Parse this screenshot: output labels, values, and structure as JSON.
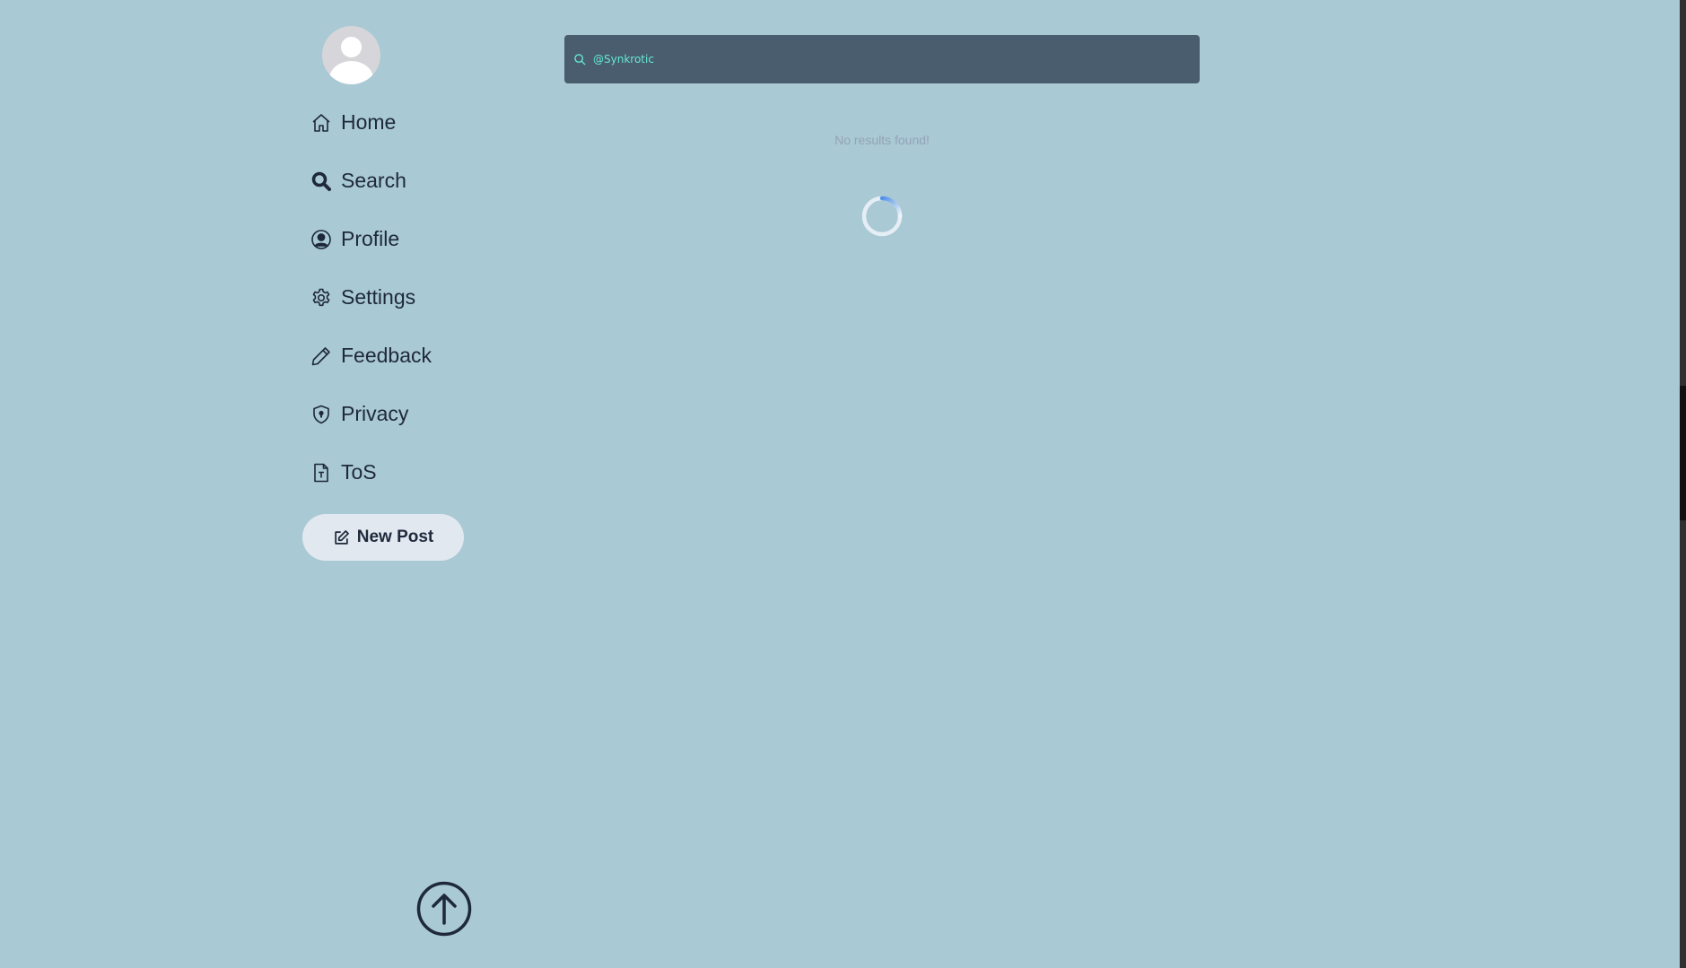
{
  "sidebar": {
    "nav": [
      {
        "label": "Home",
        "icon": "home-icon"
      },
      {
        "label": "Search",
        "icon": "search-icon"
      },
      {
        "label": "Profile",
        "icon": "user-circle-icon"
      },
      {
        "label": "Settings",
        "icon": "gear-icon"
      },
      {
        "label": "Feedback",
        "icon": "pencil-icon"
      },
      {
        "label": "Privacy",
        "icon": "shield-icon"
      },
      {
        "label": "ToS",
        "icon": "document-icon"
      }
    ],
    "new_post_label": "New Post"
  },
  "search": {
    "value": "@Synkrotic"
  },
  "results": {
    "empty_message": "No results found!"
  },
  "colors": {
    "background": "#a9c9d4",
    "search_bar": "#4a5d6e",
    "search_text": "#67e8d4",
    "text": "#1e293b",
    "button": "#e2e8f0"
  }
}
